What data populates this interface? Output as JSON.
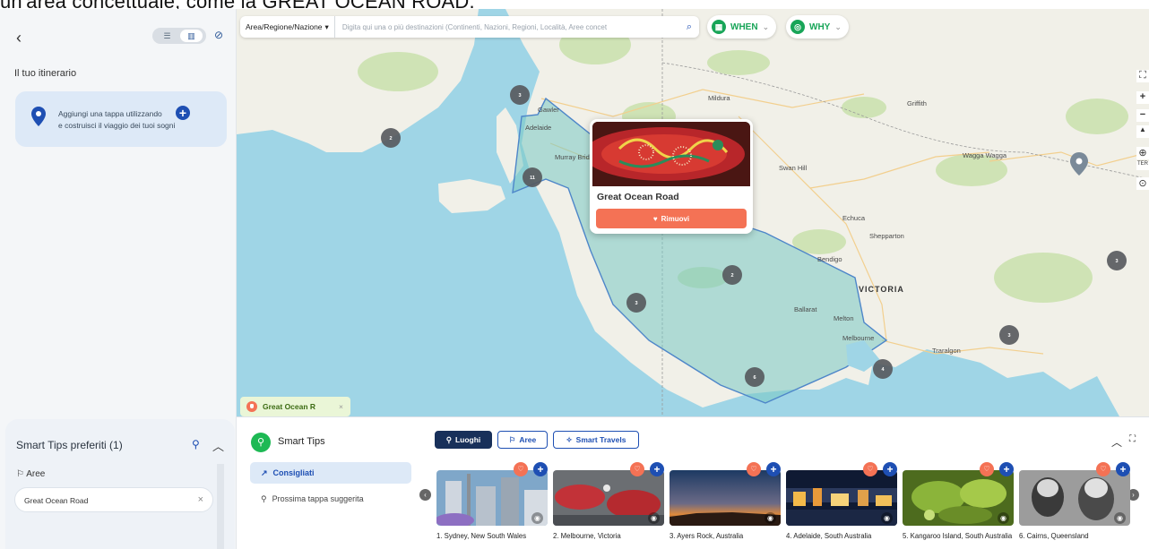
{
  "caption_cut": "un'area concettuale, come la GREAT OCEAN ROAD.",
  "left_panel": {
    "back_icon": "chevron-left-icon",
    "view_toggle": {
      "list_icon": "list-icon",
      "map_icon": "map-icon"
    },
    "hide_icon": "eye-off-icon",
    "title": "Il tuo itinerario",
    "add_card": {
      "text_line1": "Aggiungi una tappa utilizzando",
      "text_line2": "e costruisci il viaggio dei tuoi sogni",
      "plus": "+"
    }
  },
  "favorites": {
    "title": "Smart Tips preferiti (1)",
    "section": "Aree",
    "item": "Great Ocean Road",
    "remove": "×"
  },
  "search": {
    "area_select": "Area/Regione/Nazione",
    "placeholder": "Digita qui una o più destinazioni (Continenti, Nazioni, Regioni, Località, Aree concet",
    "search_icon": "search-icon"
  },
  "filters": {
    "when": "WHEN",
    "why": "WHY"
  },
  "map": {
    "labels": {
      "adelaide": "Adelaide",
      "murray_bridge": "Murray Brid",
      "gawler": "Gawler",
      "mildura": "Mildura",
      "griffith": "Griffith",
      "swan_hill": "Swan Hill",
      "wagga_wagga": "Wagga Wagga",
      "echuca": "Echuca",
      "shepparton": "Shepparton",
      "bendigo": "Bendigo",
      "victoria": "VICTORIA",
      "ballarat": "Ballarat",
      "melton": "Melton",
      "melbourne": "Melbourne",
      "traralgon": "Traralgon"
    },
    "clusters": [
      "3",
      "2",
      "11",
      "2",
      "3",
      "6",
      "4",
      "3",
      "3"
    ],
    "popup": {
      "title": "Great Ocean Road",
      "button": "Rimuovi"
    },
    "chip": "Great Ocean R",
    "chip_close": "×",
    "tools": [
      "⛶",
      "+",
      "−",
      "▲",
      "⊕",
      "TER",
      "⊙"
    ]
  },
  "tips": {
    "title": "Smart Tips",
    "tabs": [
      "Luoghi",
      "Aree",
      "Smart Travels"
    ],
    "side": [
      "Consigliati",
      "Prossima tappa suggerita"
    ],
    "cards": [
      {
        "label": "1. Sydney, New South Wales"
      },
      {
        "label": "2. Melbourne, Victoria"
      },
      {
        "label": "3. Ayers Rock, Australia"
      },
      {
        "label": "4. Adelaide, South Australia"
      },
      {
        "label": "5. Kangaroo Island, South Australia"
      },
      {
        "label": "6. Cairns, Queensland"
      }
    ]
  },
  "colors": {
    "accent_blue": "#1e4fb3",
    "green": "#18a558",
    "coral": "#f47255",
    "water": "#9fd5e6",
    "land": "#f1f0e8"
  }
}
